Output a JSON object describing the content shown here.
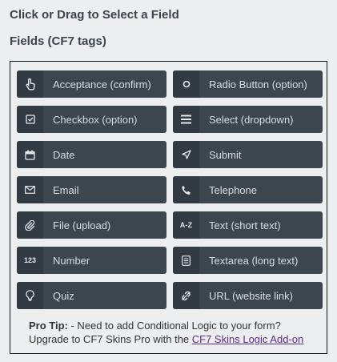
{
  "header": {
    "title": "Click or Drag to Select a Field",
    "subtitle": "Fields (CF7 tags)"
  },
  "fields": [
    {
      "label": "Acceptance (confirm)",
      "icon": "hand-pointer-icon"
    },
    {
      "label": "Radio Button (option)",
      "icon": "radio-circle-icon"
    },
    {
      "label": "Checkbox (option)",
      "icon": "checkbox-icon"
    },
    {
      "label": "Select (dropdown)",
      "icon": "menu-lines-icon"
    },
    {
      "label": "Date",
      "icon": "calendar-icon"
    },
    {
      "label": "Submit",
      "icon": "send-arrow-icon"
    },
    {
      "label": "Email",
      "icon": "envelope-icon"
    },
    {
      "label": "Telephone",
      "icon": "phone-icon"
    },
    {
      "label": "File (upload)",
      "icon": "paperclip-icon"
    },
    {
      "label": "Text (short text)",
      "icon": "a-z-icon",
      "icon_text": "A-Z"
    },
    {
      "label": "Number",
      "icon": "number-123-icon",
      "icon_text": "123"
    },
    {
      "label": "Textarea (long text)",
      "icon": "document-lines-icon"
    },
    {
      "label": "Quiz",
      "icon": "lightbulb-icon"
    },
    {
      "label": "URL (website link)",
      "icon": "link-broken-icon"
    }
  ],
  "tip": {
    "heading": "Pro Tip:",
    "line1": " - Need to add Conditional Logic to your form?",
    "line2": "Upgrade to CF7 Skins Pro with the ",
    "link": "CF7 Skins Logic Add-on"
  },
  "colors": {
    "button_bg": "#3c464f",
    "icon_bg": "#323b43",
    "button_text": "#d9dde1",
    "link": "#5b2b91"
  }
}
